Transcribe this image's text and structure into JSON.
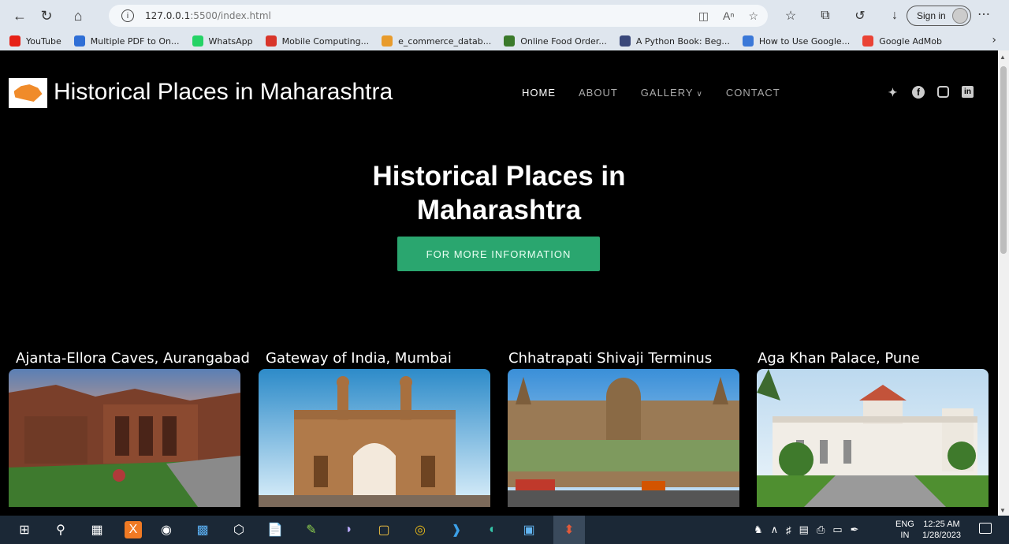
{
  "browser": {
    "url_host": "127.0.0.1",
    "url_rest": ":5500/index.html",
    "signin_label": "Sign in",
    "bookmarks": [
      {
        "label": "YouTube",
        "color": "#e62117"
      },
      {
        "label": "Multiple PDF to On...",
        "color": "#2f6fd6"
      },
      {
        "label": "WhatsApp",
        "color": "#25d366"
      },
      {
        "label": "Mobile Computing...",
        "color": "#d8352a"
      },
      {
        "label": "e_commerce_datab...",
        "color": "#e89b2c"
      },
      {
        "label": "Online Food Order...",
        "color": "#3b7a2b"
      },
      {
        "label": "A Python Book: Beg...",
        "color": "#39477a"
      },
      {
        "label": "How to Use Google...",
        "color": "#3a78d8"
      },
      {
        "label": "Google AdMob",
        "color": "#ea4335"
      }
    ]
  },
  "site": {
    "title": "Historical Places in Maharashtra",
    "nav": [
      {
        "label": "HOME",
        "active": true
      },
      {
        "label": "ABOUT",
        "active": false
      },
      {
        "label": "GALLERY",
        "active": false
      },
      {
        "label": "CONTACT",
        "active": false
      }
    ],
    "social": [
      "twitter-icon",
      "facebook-icon",
      "instagram-icon",
      "linkedin-icon"
    ]
  },
  "hero": {
    "line1": "Historical Places in",
    "line2": "Maharashtra",
    "button": "FOR MORE INFORMATION",
    "button_color": "#2aa66f"
  },
  "cards": [
    {
      "title": "Ajanta-Ellora Caves, Aurangabad"
    },
    {
      "title": "Gateway of India, Mumbai"
    },
    {
      "title": "Chhatrapati Shivaji Terminus"
    },
    {
      "title": "Aga Khan Palace, Pune"
    }
  ],
  "taskbar": {
    "lang_top": "ENG",
    "lang_bottom": "IN",
    "time": "12:25 AM",
    "date": "1/28/2023"
  }
}
